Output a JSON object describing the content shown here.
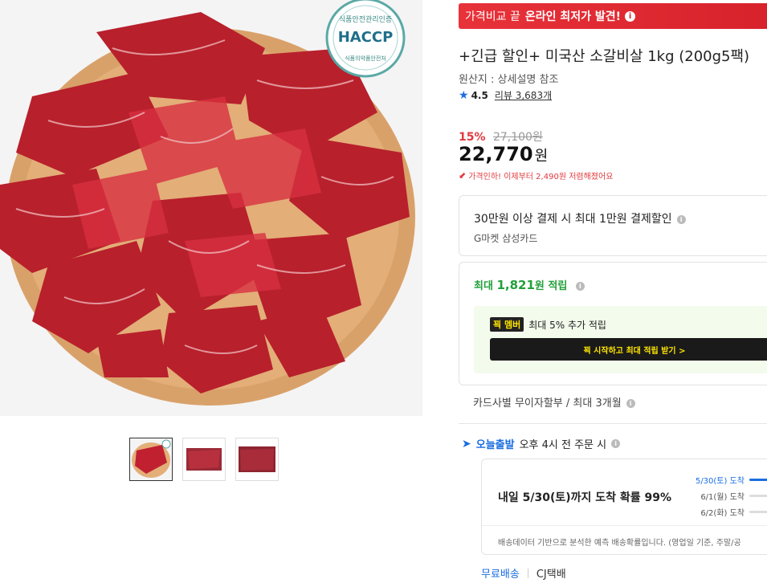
{
  "banner": {
    "text_plain": "가격비교 끝",
    "text_bold": "온라인 최저가 발견!",
    "info": "i"
  },
  "product": {
    "title": "+긴급 할인+ 미국산 소갈비살 1kg (200g5팩)",
    "origin": "원산지 : 상세설명 참조",
    "rating": "4.5",
    "review_label": "리뷰 3,683개",
    "haccp_top": "식품안전관리인증",
    "haccp_main": "HACCP",
    "haccp_bottom": "식품의약품안전처"
  },
  "price": {
    "discount_pct": "15%",
    "original": "27,100원",
    "current": "22,770",
    "currency": "원",
    "note": "가격인하! 이제부터 2,490원 저렴해졌어요"
  },
  "card_discount": {
    "line1": "30만원 이상 결제 시 최대 1만원 결제할인",
    "line2": "G마켓 삼성카드"
  },
  "points": {
    "max_prefix": "최대",
    "max_amount": "1,821",
    "max_suffix": "원 적립",
    "member_badge": "꾁 멤버",
    "member_text": "최대 5% 추가 적립",
    "member_button": "꾁 시작하고 최대 적립 받기 >"
  },
  "installment": "카드사별 무이자할부 / 최대 3개월",
  "delivery": {
    "tag": "오늘출발",
    "cutoff": "오후 4시 전 주문 시",
    "probability": "내일 5/30(토)까지 도착 확률 99%",
    "dates": [
      {
        "label": "5/30(토) 도착",
        "active": true
      },
      {
        "label": "6/1(월) 도착",
        "active": false
      },
      {
        "label": "6/2(화) 도착",
        "active": false
      }
    ],
    "note": "배송데이터 기반으로 분석한 예측 배송확률입니다. (영업일 기준, 주말/공",
    "free": "무료배송",
    "carrier": "CJ택배"
  },
  "colors": {
    "accent": "#e8323a",
    "blue": "#1a6de0",
    "green": "#22a03a"
  }
}
